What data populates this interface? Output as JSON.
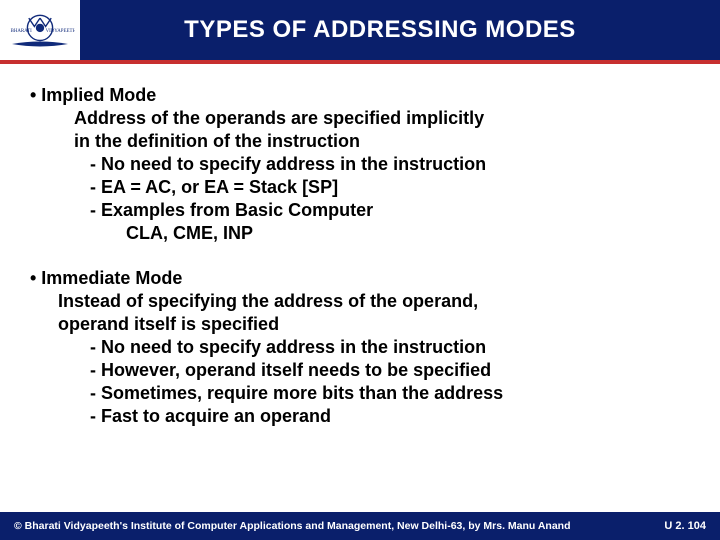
{
  "header": {
    "title": "TYPES  OF  ADDRESSING  MODES"
  },
  "content": {
    "block1": {
      "head": "• Implied Mode",
      "l1": "Address of the operands are specified implicitly",
      "l2": "in the definition of the instruction",
      "l3": "- No need to specify address in the instruction",
      "l4": "- EA = AC, or EA = Stack [SP]",
      "l5": "- Examples from Basic Computer",
      "l6": "CLA, CME, INP"
    },
    "block2": {
      "head": "• Immediate Mode",
      "l1": "Instead of specifying the address of the operand,",
      "l2": "operand itself is specified",
      "l3": "- No need to specify address in the instruction",
      "l4": "- However, operand itself needs to be specified",
      "l5": "- Sometimes, require more bits than the address",
      "l6": "- Fast to acquire an operand"
    }
  },
  "footer": {
    "copyright": "© Bharati Vidyapeeth's Institute of Computer Applications and Management, New Delhi-63, by Mrs. Manu Anand",
    "pageref": "U 2. 104"
  }
}
